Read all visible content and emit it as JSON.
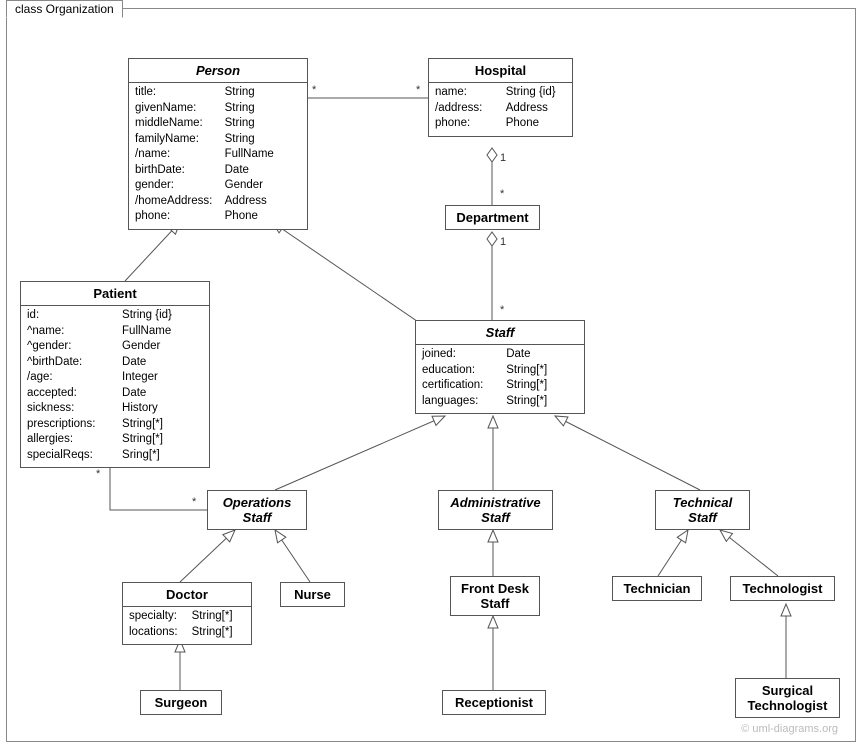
{
  "frame": {
    "label": "class Organization"
  },
  "watermark": "© uml-diagrams.org",
  "classes": {
    "person": {
      "name": "Person",
      "attrs": [
        {
          "n": "title:",
          "t": "String"
        },
        {
          "n": "givenName:",
          "t": "String"
        },
        {
          "n": "middleName:",
          "t": "String"
        },
        {
          "n": "familyName:",
          "t": "String"
        },
        {
          "n": "/name:",
          "t": "FullName"
        },
        {
          "n": "birthDate:",
          "t": "Date"
        },
        {
          "n": "gender:",
          "t": "Gender"
        },
        {
          "n": "/homeAddress:",
          "t": "Address"
        },
        {
          "n": "phone:",
          "t": "Phone"
        }
      ]
    },
    "hospital": {
      "name": "Hospital",
      "attrs": [
        {
          "n": "name:",
          "t": "String {id}"
        },
        {
          "n": "/address:",
          "t": "Address"
        },
        {
          "n": "phone:",
          "t": "Phone"
        }
      ]
    },
    "department": {
      "name": "Department"
    },
    "patient": {
      "name": "Patient",
      "attrs": [
        {
          "n": "id:",
          "t": "String {id}"
        },
        {
          "n": "^name:",
          "t": "FullName"
        },
        {
          "n": "^gender:",
          "t": "Gender"
        },
        {
          "n": "^birthDate:",
          "t": "Date"
        },
        {
          "n": "/age:",
          "t": "Integer"
        },
        {
          "n": "accepted:",
          "t": "Date"
        },
        {
          "n": "sickness:",
          "t": "History"
        },
        {
          "n": "prescriptions:",
          "t": "String[*]"
        },
        {
          "n": "allergies:",
          "t": "String[*]"
        },
        {
          "n": "specialReqs:",
          "t": "Sring[*]"
        }
      ]
    },
    "staff": {
      "name": "Staff",
      "attrs": [
        {
          "n": "joined:",
          "t": "Date"
        },
        {
          "n": "education:",
          "t": "String[*]"
        },
        {
          "n": "certification:",
          "t": "String[*]"
        },
        {
          "n": "languages:",
          "t": "String[*]"
        }
      ]
    },
    "opsStaff": {
      "name": "Operations",
      "name2": "Staff"
    },
    "adminStaff": {
      "name": "Administrative",
      "name2": "Staff"
    },
    "techStaff": {
      "name": "Technical",
      "name2": "Staff"
    },
    "doctor": {
      "name": "Doctor",
      "attrs": [
        {
          "n": "specialty:",
          "t": "String[*]"
        },
        {
          "n": "locations:",
          "t": "String[*]"
        }
      ]
    },
    "nurse": {
      "name": "Nurse"
    },
    "frontDesk": {
      "name": "Front Desk",
      "name2": "Staff"
    },
    "technician": {
      "name": "Technician"
    },
    "technologist": {
      "name": "Technologist"
    },
    "surgeon": {
      "name": "Surgeon"
    },
    "receptionist": {
      "name": "Receptionist"
    },
    "surgTech": {
      "name": "Surgical",
      "name2": "Technologist"
    }
  },
  "mult": {
    "person_hospital_left": "*",
    "person_hospital_right": "*",
    "hospital_dept_top": "1",
    "hospital_dept_bottom": "*",
    "dept_staff_top": "1",
    "dept_staff_bottom": "*",
    "patient_ops_left": "*",
    "patient_ops_right": "*"
  }
}
